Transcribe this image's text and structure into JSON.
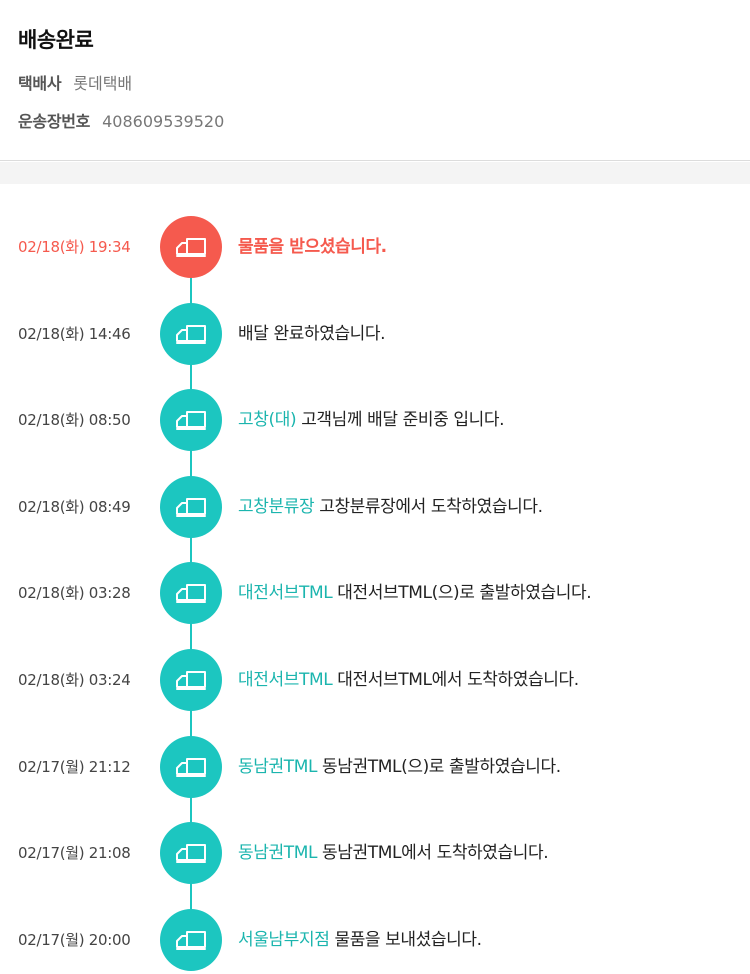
{
  "header": {
    "status": "배송완료",
    "carrier_label": "택배사",
    "carrier_value": "롯데택배",
    "tracking_label": "운송장번호",
    "tracking_value": "408609539520"
  },
  "colors": {
    "accent": "#1cc6c0",
    "latest": "#f55a4e"
  },
  "events": [
    {
      "time": "02/18(화) 19:34",
      "location": "",
      "message": "물품을 받으셨습니다.",
      "icon": "truck-icon"
    },
    {
      "time": "02/18(화) 14:46",
      "location": "",
      "message": "배달 완료하였습니다.",
      "icon": "truck-icon"
    },
    {
      "time": "02/18(화) 08:50",
      "location": "고창(대)",
      "message": " 고객님께 배달 준비중 입니다.",
      "icon": "truck-icon"
    },
    {
      "time": "02/18(화) 08:49",
      "location": "고창분류장",
      "message": " 고창분류장에서 도착하였습니다.",
      "icon": "truck-icon"
    },
    {
      "time": "02/18(화) 03:28",
      "location": "대전서브TML",
      "message": " 대전서브TML(으)로 출발하였습니다.",
      "icon": "truck-icon"
    },
    {
      "time": "02/18(화) 03:24",
      "location": "대전서브TML",
      "message": " 대전서브TML에서 도착하였습니다.",
      "icon": "truck-icon"
    },
    {
      "time": "02/17(월) 21:12",
      "location": "동남권TML",
      "message": " 동남권TML(으)로 출발하였습니다.",
      "icon": "truck-icon"
    },
    {
      "time": "02/17(월) 21:08",
      "location": "동남권TML",
      "message": " 동남권TML에서 도착하였습니다.",
      "icon": "truck-icon"
    },
    {
      "time": "02/17(월) 20:00",
      "location": "서울남부지점",
      "message": " 물품을 보내셨습니다.",
      "icon": "truck-icon"
    }
  ]
}
